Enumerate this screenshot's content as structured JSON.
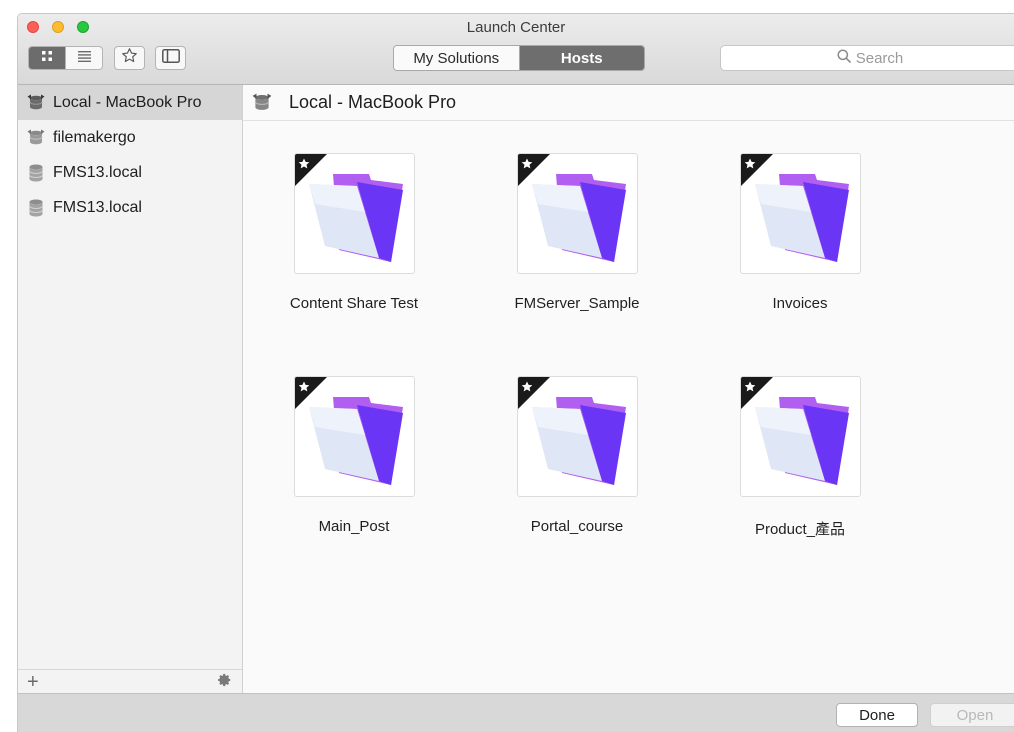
{
  "window": {
    "title": "Launch Center"
  },
  "toolbar": {
    "view_grid_icon": "grid-icon",
    "view_list_icon": "list-icon",
    "favorite_icon": "star-icon",
    "sidebar_icon": "sidebar-icon",
    "tabs": [
      {
        "label": "My Solutions",
        "active": false
      },
      {
        "label": "Hosts",
        "active": true
      }
    ],
    "search_placeholder": "Search"
  },
  "sidebar": {
    "items": [
      {
        "label": "Local - MacBook Pro",
        "selected": true,
        "icon": "local-host-icon"
      },
      {
        "label": "filemakergo",
        "selected": false,
        "icon": "local-host-icon"
      },
      {
        "label": "FMS13.local",
        "selected": false,
        "icon": "server-icon"
      },
      {
        "label": "FMS13.local",
        "selected": false,
        "icon": "server-icon"
      }
    ],
    "footer": {
      "add_label": "+",
      "settings_icon": "gear-icon"
    }
  },
  "main": {
    "header_title": "Local - MacBook Pro",
    "files": [
      {
        "label": "Content Share Test"
      },
      {
        "label": "FMServer_Sample"
      },
      {
        "label": "Invoices"
      },
      {
        "label": "Main_Post"
      },
      {
        "label": "Portal_course"
      },
      {
        "label": "Product_產品"
      }
    ]
  },
  "bottom": {
    "done_label": "Done",
    "open_label": "Open"
  },
  "colors": {
    "folder_purple": "#a24ce0",
    "folder_blue": "#5b2cf0",
    "selected_tab": "#6e6e6e"
  }
}
